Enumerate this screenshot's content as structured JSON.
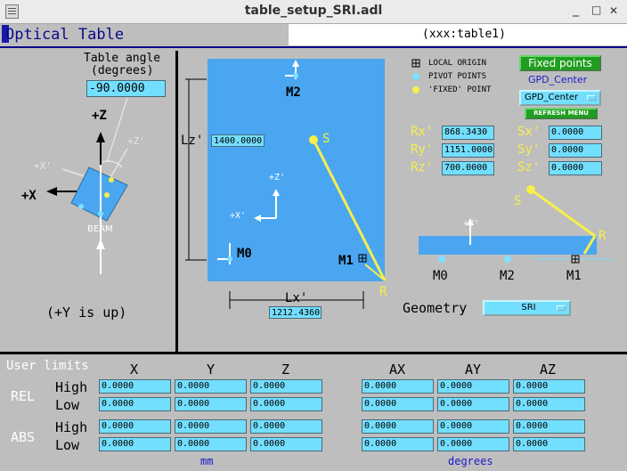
{
  "window": {
    "title": "table_setup_SRI.adl",
    "minimize": "_",
    "maximize": "□",
    "close": "✕"
  },
  "header": {
    "title": "Optical Table",
    "pv": "(xxx:table1)"
  },
  "left": {
    "angle_label_1": "Table angle",
    "angle_label_2": "(degrees)",
    "angle_value": "-90.0000",
    "plus_z": "+Z",
    "plus_x": "+X",
    "plus_z_prime": "+Z'",
    "plus_x_prime": "+X'",
    "beam": "BEAM",
    "y_up": "(+Y is up)"
  },
  "table": {
    "lz_label": "Lz'",
    "lz_value": "1400.0000",
    "lx_label": "Lx'",
    "lx_value": "1212.4360",
    "m2": "M2",
    "m0": "M0",
    "m1": "M1",
    "s": "S",
    "r": "R",
    "plus_z_prime": "+Z'",
    "plus_x_prime": "+X'"
  },
  "legend": {
    "local_origin": "LOCAL ORIGIN",
    "pivot_points": "PIVOT POINTS",
    "fixed_point": "'FIXED' POINT"
  },
  "fixed": {
    "button": "Fixed points",
    "name": "GPD_Center",
    "menu": "GPD_Center",
    "refresh": "REFRESH MENU"
  },
  "coords": {
    "rx_label": "Rx'",
    "rx": "868.3430",
    "ry_label": "Ry'",
    "ry": "1151.0000",
    "rz_label": "Rz'",
    "rz": "700.0000",
    "sx_label": "Sx'",
    "sx": "0.0000",
    "sy_label": "Sy'",
    "sy": "0.0000",
    "sz_label": "Sz'",
    "sz": "0.0000"
  },
  "side": {
    "plus_y_prime": "+Y'",
    "s": "S",
    "r": "R",
    "m0": "M0",
    "m2": "M2",
    "m1": "M1"
  },
  "geometry": {
    "label": "Geometry",
    "value": "SRI"
  },
  "limits": {
    "title": "User limits",
    "rel": "REL",
    "abs": "ABS",
    "high": "High",
    "low": "Low",
    "cols_lin": [
      "X",
      "Y",
      "Z"
    ],
    "cols_ang": [
      "AX",
      "AY",
      "AZ"
    ],
    "rel_high": [
      "0.0000",
      "0.0000",
      "0.0000",
      "0.0000",
      "0.0000",
      "0.0000"
    ],
    "rel_low": [
      "0.0000",
      "0.0000",
      "0.0000",
      "0.0000",
      "0.0000",
      "0.0000"
    ],
    "abs_high": [
      "0.0000",
      "0.0000",
      "0.0000",
      "0.0000",
      "0.0000",
      "0.0000"
    ],
    "abs_low": [
      "0.0000",
      "0.0000",
      "0.0000",
      "0.0000",
      "0.0000",
      "0.0000"
    ],
    "unit_mm": "mm",
    "unit_deg": "degrees"
  },
  "colors": {
    "table_blue": "#4aa6f0",
    "field_cyan": "#73dfff",
    "beam_yellow": "#f7ef4a",
    "button_green": "#1f9f1f"
  }
}
